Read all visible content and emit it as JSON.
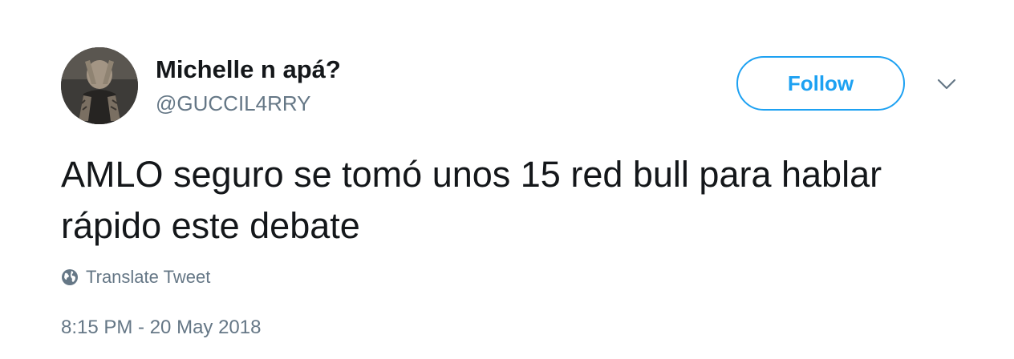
{
  "author": {
    "display_name": "Michelle n apá?",
    "handle": "@GUCCIL4RRY",
    "avatar_icon": "profile-photo"
  },
  "actions": {
    "follow_label": "Follow",
    "more_icon": "chevron-down-icon"
  },
  "tweet": {
    "text": "AMLO seguro se tomó unos 15 red bull para hablar rápido este debate",
    "translate_label": "Translate Tweet",
    "translate_icon": "globe-icon",
    "timestamp": "8:15 PM - 20 May 2018"
  },
  "colors": {
    "accent": "#1da1f2",
    "text_primary": "#14171a",
    "text_secondary": "#657786"
  }
}
